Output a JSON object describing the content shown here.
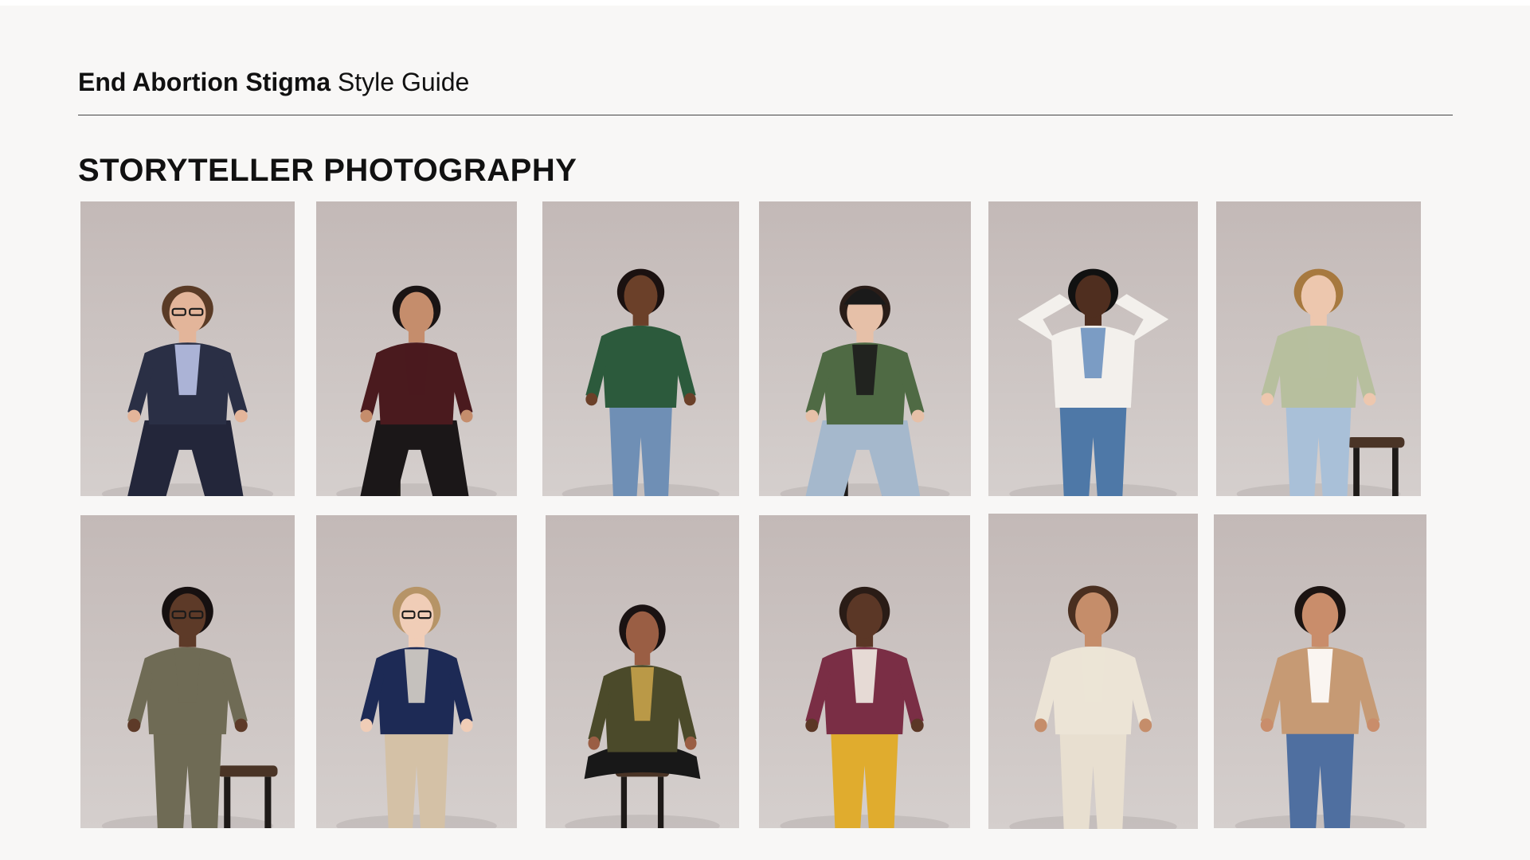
{
  "header": {
    "brand": "End Abortion Stigma",
    "subtitle": "Style Guide"
  },
  "section": {
    "title": "STORYTELLER PHOTOGRAPHY"
  },
  "photos": [
    {
      "id": "portrait-1",
      "skin": "#e3b59a",
      "hair": "#5a3b26",
      "top": "#2a2f45",
      "bottom": "#23263a",
      "accent": "#b9c2e6",
      "pose": "seated",
      "stool": false,
      "glasses": true
    },
    {
      "id": "portrait-2",
      "skin": "#c58d6c",
      "hair": "#1a1414",
      "top": "#4a1a1e",
      "bottom": "#1b1718",
      "accent": "#4a1a1e",
      "pose": "seated",
      "stool": true,
      "glasses": false
    },
    {
      "id": "portrait-3",
      "skin": "#6b4029",
      "hair": "#1b1110",
      "top": "#2c5a3c",
      "bottom": "#6f8fb5",
      "accent": "#2c5a3c",
      "pose": "standing",
      "stool": false,
      "glasses": false
    },
    {
      "id": "portrait-4",
      "skin": "#e6c0a8",
      "hair": "#2a1d18",
      "top": "#4f6a44",
      "bottom": "#a5b8cc",
      "accent": "#1c1c1c",
      "pose": "seated",
      "stool": true,
      "glasses": false,
      "hat": true
    },
    {
      "id": "portrait-5",
      "skin": "#4f2e1f",
      "hair": "#111111",
      "top": "#f3f0ec",
      "bottom": "#4e78a7",
      "accent": "#6e92c0",
      "pose": "heart",
      "stool": false,
      "glasses": false
    },
    {
      "id": "portrait-6",
      "skin": "#edc7ae",
      "hair": "#a7793f",
      "top": "#b7bf9e",
      "bottom": "#a9c0d8",
      "accent": "#b7bf9e",
      "pose": "standing",
      "stool": true,
      "glasses": false
    },
    {
      "id": "portrait-7",
      "skin": "#5d3a28",
      "hair": "#161010",
      "top": "#6f6b55",
      "bottom": "#6f6b55",
      "accent": "#6f6b55",
      "pose": "standing",
      "stool": true,
      "glasses": true
    },
    {
      "id": "portrait-8",
      "skin": "#f0cdb7",
      "hair": "#b69467",
      "top": "#1d2a55",
      "bottom": "#d4c1a6",
      "accent": "#d8d2c9",
      "pose": "standing",
      "stool": false,
      "glasses": true
    },
    {
      "id": "portrait-9",
      "skin": "#9a5e44",
      "hair": "#1a1212",
      "top": "#4b4a2a",
      "bottom": "#181818",
      "accent": "#c7a24a",
      "pose": "crosslegged",
      "stool": true,
      "glasses": false
    },
    {
      "id": "portrait-10",
      "skin": "#5b3726",
      "hair": "#2a1c16",
      "top": "#7a2e45",
      "bottom": "#e0ac2e",
      "accent": "#f2ede4",
      "pose": "standing",
      "stool": false,
      "glasses": false
    },
    {
      "id": "portrait-11",
      "skin": "#c58d6a",
      "hair": "#4a2f20",
      "top": "#ece4d6",
      "bottom": "#e8dfd0",
      "accent": "#ece4d6",
      "pose": "standing",
      "stool": false,
      "glasses": false
    },
    {
      "id": "portrait-12",
      "skin": "#c98d6b",
      "hair": "#1c1412",
      "top": "#c69a74",
      "bottom": "#4f6fa0",
      "accent": "#ffffff",
      "pose": "standing",
      "stool": false,
      "glasses": false
    }
  ]
}
